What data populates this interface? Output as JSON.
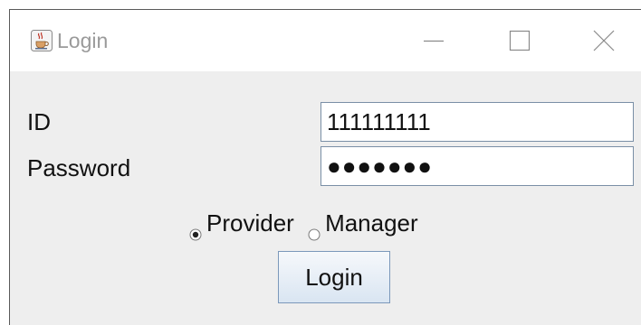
{
  "window": {
    "title": "Login",
    "icon": "java-cup-icon"
  },
  "form": {
    "id_label": "ID",
    "id_value": "111111111",
    "password_label": "Password",
    "password_value": "●●●●●●●"
  },
  "role": {
    "options": [
      {
        "label": "Provider",
        "selected": true
      },
      {
        "label": "Manager",
        "selected": false
      }
    ]
  },
  "actions": {
    "login_label": "Login"
  }
}
